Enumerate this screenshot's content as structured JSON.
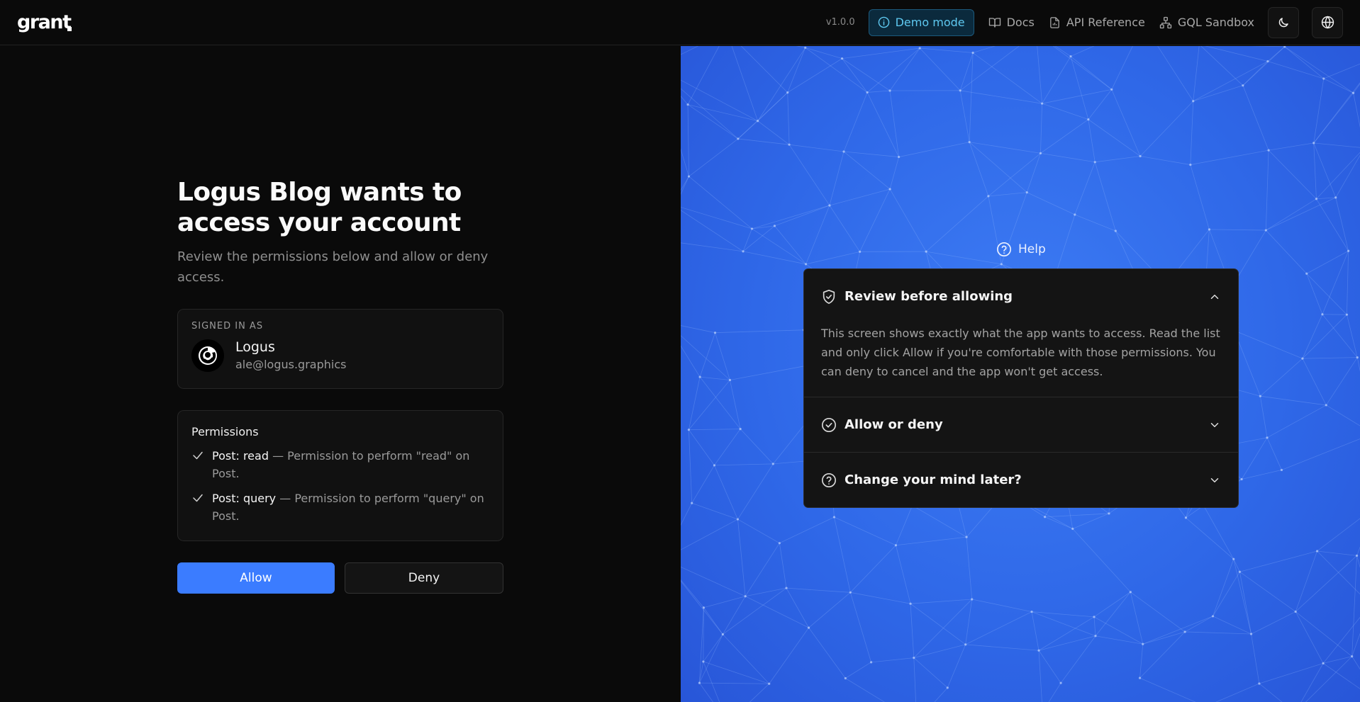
{
  "header": {
    "logo": "grant",
    "version": "v1.0.0",
    "demo_badge": "Demo mode",
    "links": [
      {
        "label": "Docs",
        "icon": "book-icon"
      },
      {
        "label": "API Reference",
        "icon": "file-icon"
      },
      {
        "label": "GQL Sandbox",
        "icon": "sitemap-icon"
      }
    ],
    "theme_toggle_icon": "moon-icon",
    "language_icon": "globe-icon"
  },
  "consent": {
    "title": "Logus Blog wants to access your account",
    "subtitle": "Review the permissions below and allow or deny access.",
    "account": {
      "label": "SIGNED IN AS",
      "name": "Logus",
      "email": "ale@logus.graphics"
    },
    "permissions": {
      "title": "Permissions",
      "items": [
        {
          "name": "Post: read",
          "description": " — Permission to perform \"read\" on Post."
        },
        {
          "name": "Post: query",
          "description": " — Permission to perform \"query\" on Post."
        }
      ]
    },
    "allow_label": "Allow",
    "deny_label": "Deny",
    "colors": {
      "allow": "#3b7cff",
      "background": "#0a0a0a"
    }
  },
  "help": {
    "title": "Help",
    "items": [
      {
        "question": "Review before allowing",
        "icon": "shield-check-icon",
        "expanded": true,
        "answer": "This screen shows exactly what the app wants to access. Read the list and only click Allow if you're comfortable with those permissions. You can deny to cancel and the app won't get access."
      },
      {
        "question": "Allow or deny",
        "icon": "circle-check-icon",
        "expanded": false
      },
      {
        "question": "Change your mind later?",
        "icon": "question-circle-icon",
        "expanded": false
      }
    ],
    "colors": {
      "panel": "#2f68e8"
    }
  }
}
